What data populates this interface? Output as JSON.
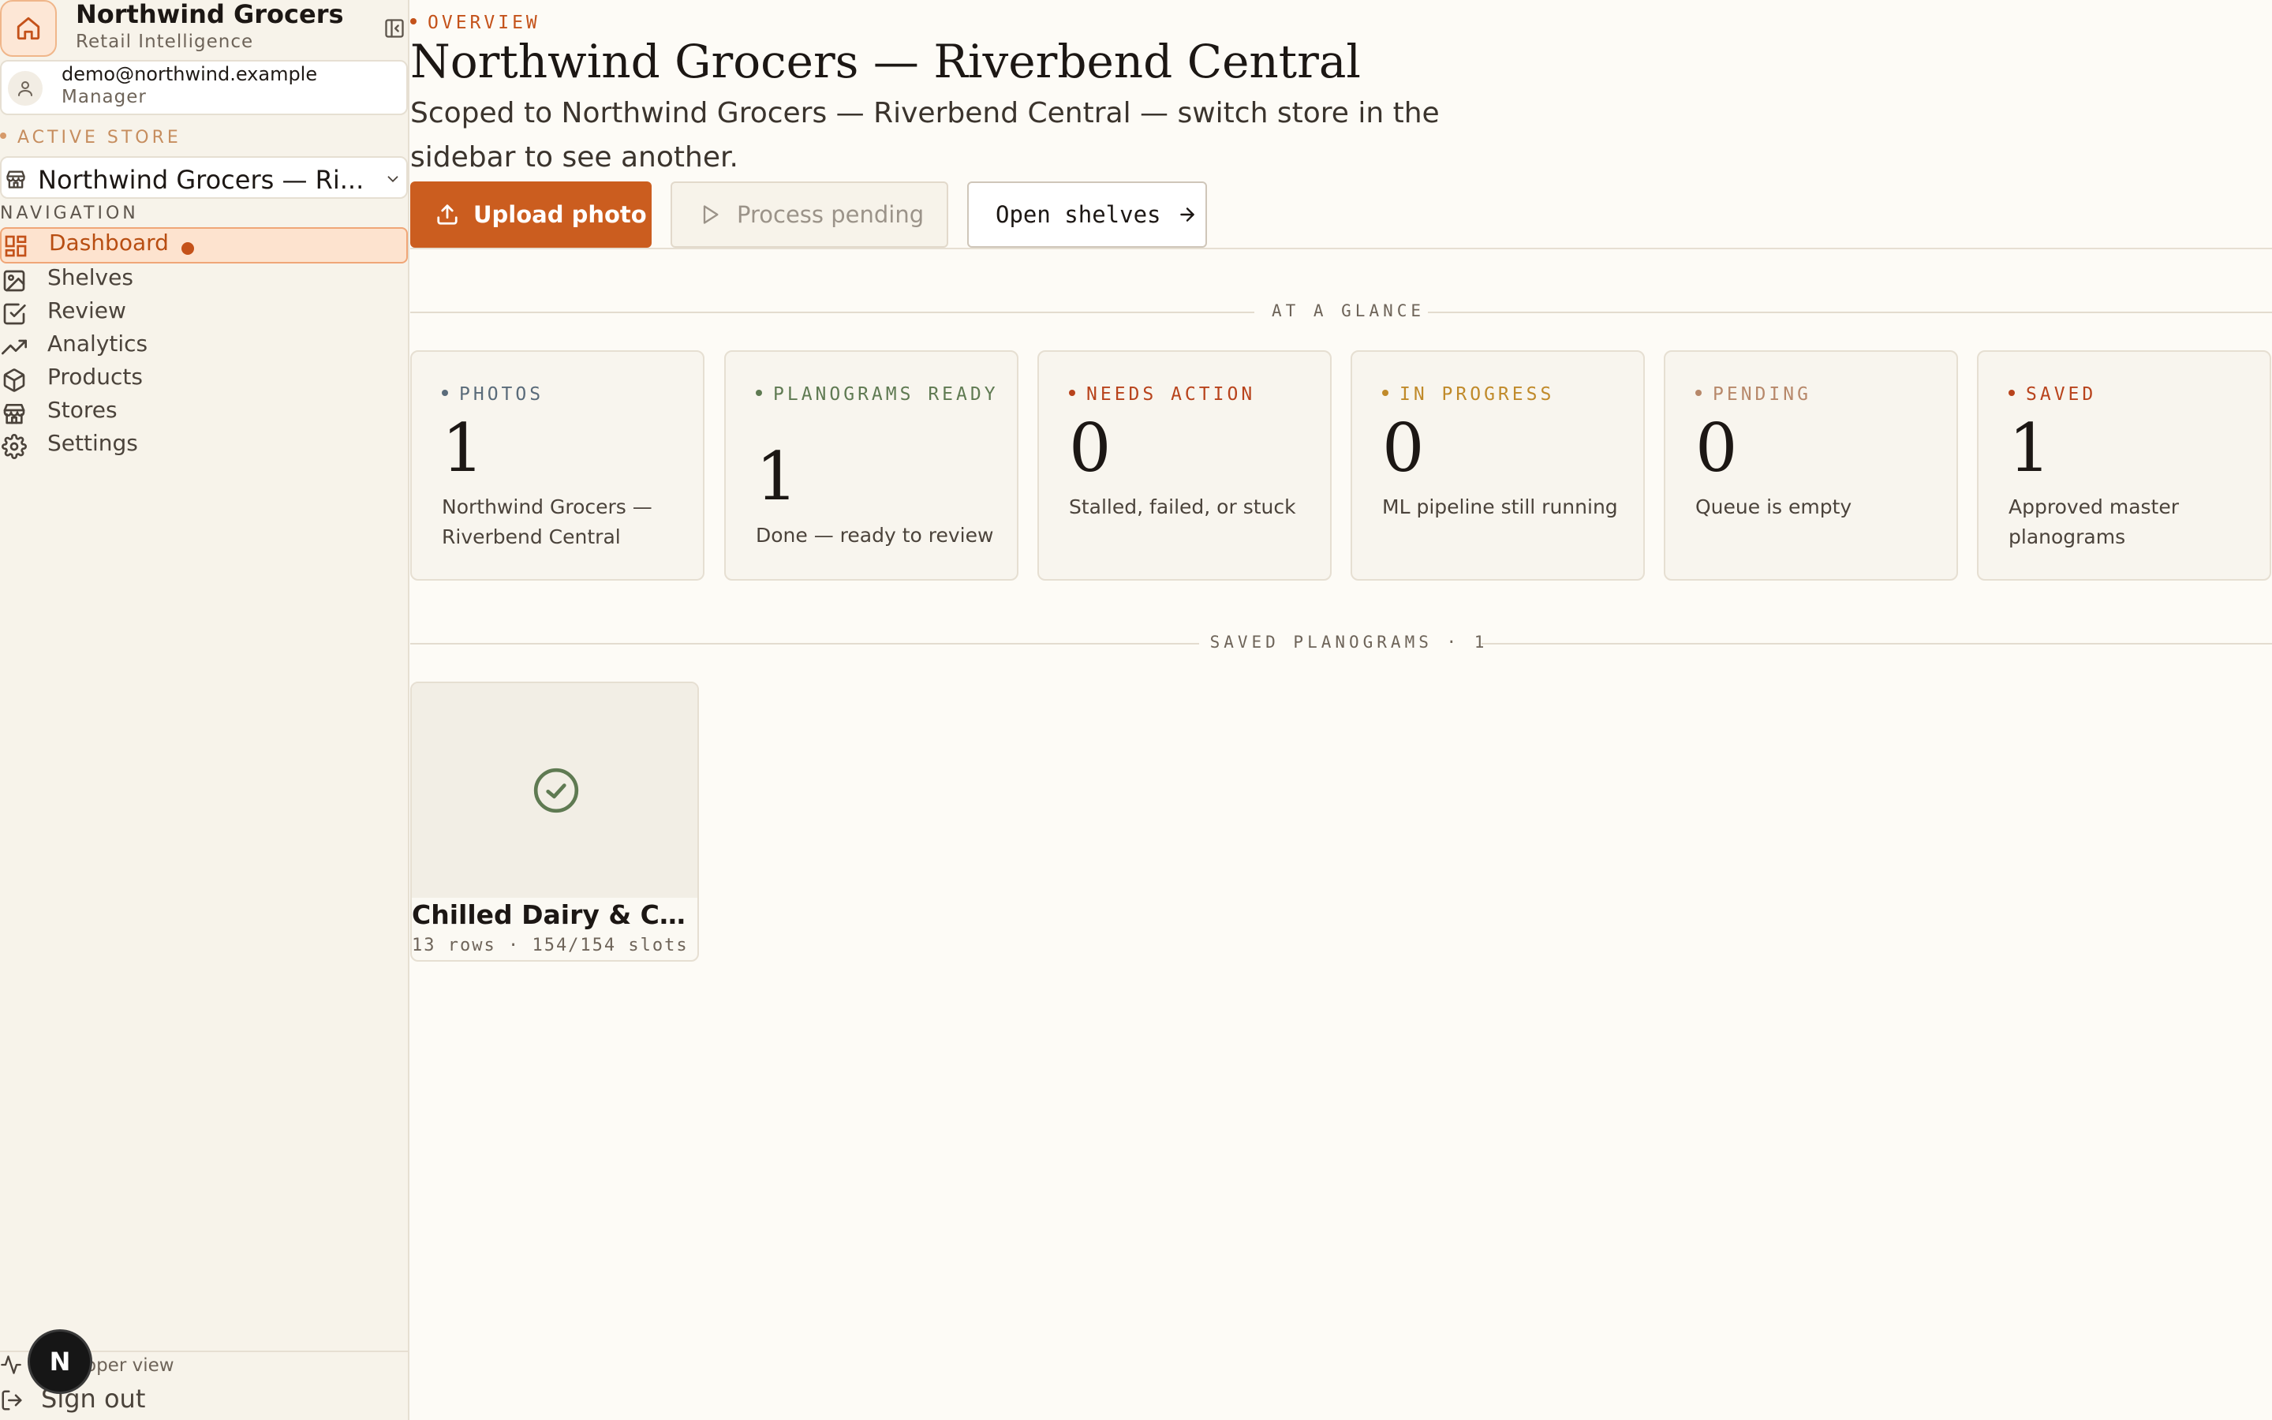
{
  "app": {
    "name": "Northwind Grocers",
    "subtitle": "Retail Intelligence"
  },
  "user": {
    "email": "demo@northwind.example",
    "role": "Manager"
  },
  "sidebar": {
    "active_store_label": "ACTIVE STORE",
    "selected_store": "Northwind Grocers — Ri...",
    "nav_label": "NAVIGATION",
    "items": [
      {
        "label": "Dashboard",
        "icon": "dashboard-icon",
        "active": true
      },
      {
        "label": "Shelves",
        "icon": "image-icon"
      },
      {
        "label": "Review",
        "icon": "check-square-icon"
      },
      {
        "label": "Analytics",
        "icon": "trending-up-icon"
      },
      {
        "label": "Products",
        "icon": "box-icon"
      },
      {
        "label": "Stores",
        "icon": "store-icon"
      },
      {
        "label": "Settings",
        "icon": "gear-icon"
      }
    ],
    "developer_view": "oper view",
    "sign_out": "Sign out",
    "avatar_badge": "N"
  },
  "header": {
    "eyebrow": "OVERVIEW",
    "title": "Northwind Grocers — Riverbend Central",
    "subtitle": "Scoped to Northwind Grocers — Riverbend Central — switch store in the sidebar to see another."
  },
  "actions": {
    "upload": "Upload photo",
    "process": "Process pending",
    "open_shelves": "Open shelves"
  },
  "glance": {
    "heading": "AT A GLANCE",
    "cards": [
      {
        "label": "PHOTOS",
        "value": "1",
        "desc": "Northwind Grocers — Riverbend Central",
        "color": "#5a6b7a"
      },
      {
        "label": "PLANOGRAMS READY",
        "value": "1",
        "desc": "Done — ready to review",
        "color": "#5f7a52"
      },
      {
        "label": "NEEDS ACTION",
        "value": "0",
        "desc": "Stalled, failed, or stuck",
        "color": "#b8431c"
      },
      {
        "label": "IN PROGRESS",
        "value": "0",
        "desc": "ML pipeline still running",
        "color": "#c08a2a"
      },
      {
        "label": "PENDING",
        "value": "0",
        "desc": "Queue is empty",
        "color": "#b7886a"
      },
      {
        "label": "SAVED",
        "value": "1",
        "desc": "Approved master planograms",
        "color": "#b8431c"
      }
    ]
  },
  "saved": {
    "heading": "SAVED PLANOGRAMS · 1",
    "items": [
      {
        "title": "Chilled Dairy & Che...",
        "meta": "13 rows · 154/154 slots"
      }
    ]
  },
  "colors": {
    "accent": "#cb5d1f",
    "sidebar_bg": "#f7f3ea",
    "page_bg": "#fdfbf6",
    "check": "#5f7a52"
  }
}
